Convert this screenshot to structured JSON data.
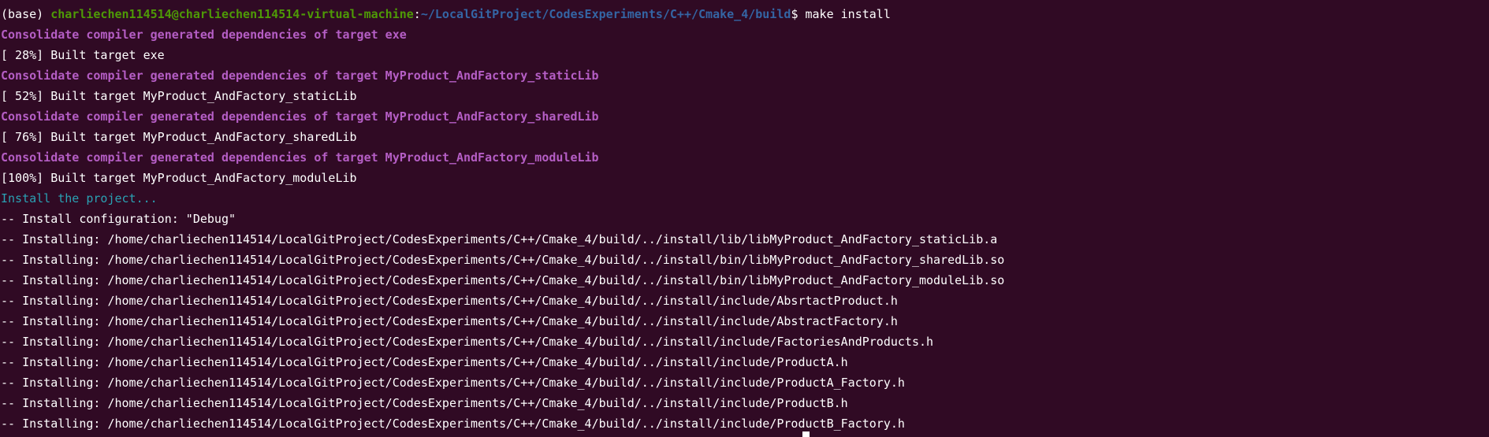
{
  "colors": {
    "background": "#300a24",
    "text": "#ffffff",
    "prompt_user": "#4e9a06",
    "prompt_path": "#3465a4",
    "consolidate": "#b55ec5",
    "install_message": "#2aa1b3"
  },
  "prompt": {
    "env": "(base) ",
    "user_host": "charliechen114514@charliechen114514-virtual-machine",
    "separator": ":",
    "path": "~/LocalGitProject/CodesExperiments/C++/Cmake_4/build",
    "symbol": "$ ",
    "command": "make install"
  },
  "output": [
    {
      "type": "consolidate",
      "text": "Consolidate compiler generated dependencies of target exe"
    },
    {
      "type": "plain",
      "text": "[ 28%] Built target exe"
    },
    {
      "type": "consolidate",
      "text": "Consolidate compiler generated dependencies of target MyProduct_AndFactory_staticLib"
    },
    {
      "type": "plain",
      "text": "[ 52%] Built target MyProduct_AndFactory_staticLib"
    },
    {
      "type": "consolidate",
      "text": "Consolidate compiler generated dependencies of target MyProduct_AndFactory_sharedLib"
    },
    {
      "type": "plain",
      "text": "[ 76%] Built target MyProduct_AndFactory_sharedLib"
    },
    {
      "type": "consolidate",
      "text": "Consolidate compiler generated dependencies of target MyProduct_AndFactory_moduleLib"
    },
    {
      "type": "plain",
      "text": "[100%] Built target MyProduct_AndFactory_moduleLib"
    },
    {
      "type": "install",
      "text": "Install the project..."
    },
    {
      "type": "plain",
      "text": "-- Install configuration: \"Debug\""
    },
    {
      "type": "plain",
      "text": "-- Installing: /home/charliechen114514/LocalGitProject/CodesExperiments/C++/Cmake_4/build/../install/lib/libMyProduct_AndFactory_staticLib.a"
    },
    {
      "type": "plain",
      "text": "-- Installing: /home/charliechen114514/LocalGitProject/CodesExperiments/C++/Cmake_4/build/../install/bin/libMyProduct_AndFactory_sharedLib.so"
    },
    {
      "type": "plain",
      "text": "-- Installing: /home/charliechen114514/LocalGitProject/CodesExperiments/C++/Cmake_4/build/../install/bin/libMyProduct_AndFactory_moduleLib.so"
    },
    {
      "type": "plain",
      "text": "-- Installing: /home/charliechen114514/LocalGitProject/CodesExperiments/C++/Cmake_4/build/../install/include/AbsrtactProduct.h"
    },
    {
      "type": "plain",
      "text": "-- Installing: /home/charliechen114514/LocalGitProject/CodesExperiments/C++/Cmake_4/build/../install/include/AbstractFactory.h"
    },
    {
      "type": "plain",
      "text": "-- Installing: /home/charliechen114514/LocalGitProject/CodesExperiments/C++/Cmake_4/build/../install/include/FactoriesAndProducts.h"
    },
    {
      "type": "plain",
      "text": "-- Installing: /home/charliechen114514/LocalGitProject/CodesExperiments/C++/Cmake_4/build/../install/include/ProductA.h"
    },
    {
      "type": "plain",
      "text": "-- Installing: /home/charliechen114514/LocalGitProject/CodesExperiments/C++/Cmake_4/build/../install/include/ProductA_Factory.h"
    },
    {
      "type": "plain",
      "text": "-- Installing: /home/charliechen114514/LocalGitProject/CodesExperiments/C++/Cmake_4/build/../install/include/ProductB.h"
    },
    {
      "type": "plain",
      "text": "-- Installing: /home/charliechen114514/LocalGitProject/CodesExperiments/C++/Cmake_4/build/../install/include/ProductB_Factory.h"
    }
  ]
}
